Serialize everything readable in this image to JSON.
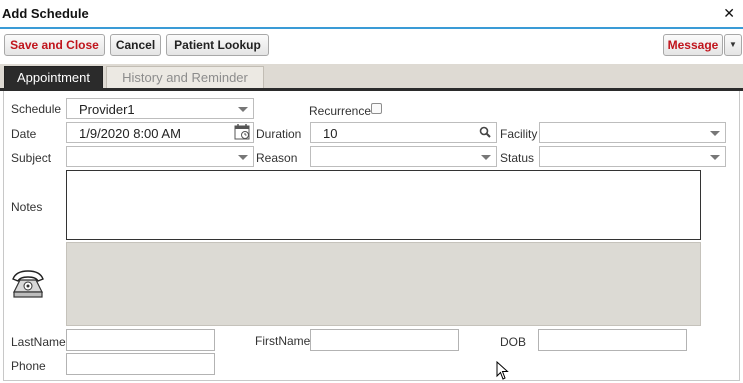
{
  "window": {
    "title": "Add Schedule",
    "close_glyph": "✕"
  },
  "toolbar": {
    "save_close": "Save and Close",
    "cancel": "Cancel",
    "patient_lookup": "Patient Lookup",
    "message": "Message"
  },
  "tabs": {
    "appointment": "Appointment",
    "history": "History and Reminder",
    "active": "Appointment"
  },
  "form": {
    "schedule_label": "Schedule",
    "schedule_value": "Provider1",
    "recurrence_label": "Recurrence",
    "recurrence_checked": false,
    "date_label": "Date",
    "date_value": "1/9/2020 8:00 AM",
    "duration_label": "Duration",
    "duration_value": "10",
    "facility_label": "Facility",
    "facility_value": "",
    "subject_label": "Subject",
    "subject_value": "",
    "reason_label": "Reason",
    "reason_value": "",
    "status_label": "Status",
    "status_value": "",
    "notes_label": "Notes",
    "notes_value": "",
    "lastname_label": "LastName",
    "lastname_value": "",
    "firstname_label": "FirstName",
    "firstname_value": "",
    "dob_label": "DOB",
    "dob_value": "",
    "phone_label": "Phone",
    "phone_value": ""
  },
  "icons": {
    "close": "close-icon",
    "calendar": "calendar-icon",
    "search": "search-icon",
    "dropdown": "chevron-down-icon",
    "telephone": "telephone-icon",
    "cursor": "mouse-pointer-icon"
  },
  "colors": {
    "accent_rule": "#3a9bd6",
    "save_text": "#c0141c",
    "message_text": "#c0141c",
    "active_tab_bg": "#2b2b2b",
    "tab_strip_bg": "#dedad3",
    "grey_panel": "#dcdad4"
  }
}
